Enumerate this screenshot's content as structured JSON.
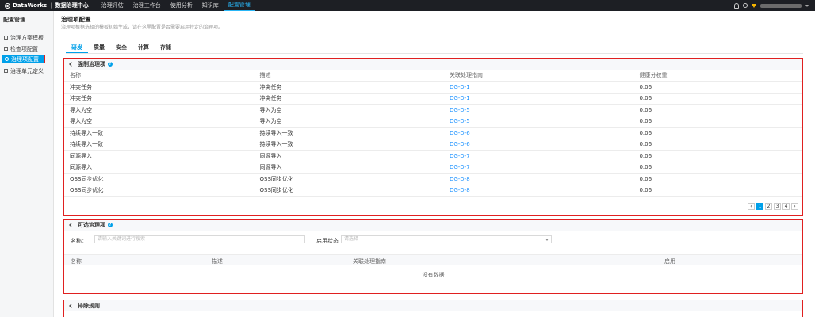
{
  "topbar": {
    "brand": "DataWorks",
    "product": "数据治理中心",
    "nav": [
      "治理评估",
      "治理工作台",
      "使用分析",
      "知识库",
      "配置管理"
    ],
    "active_nav": 4
  },
  "sidebar": {
    "title": "配置管理",
    "items": [
      {
        "label": "治理方案模板"
      },
      {
        "label": "检查项配置"
      },
      {
        "label": "治理项配置"
      },
      {
        "label": "治理单元定义"
      }
    ],
    "active": 2
  },
  "page": {
    "title": "治理项配置",
    "desc": "治理项根据选择的模板初始生成，请在这里配置是否需要启用特定的治理项。"
  },
  "tabs": [
    "研发",
    "质量",
    "安全",
    "计算",
    "存储"
  ],
  "forced": {
    "title": "强制治理项",
    "help": "?",
    "columns": [
      "名称",
      "描述",
      "关联处理指南",
      "健康分权重"
    ],
    "rows": [
      [
        "冲突任务",
        "冲突任务",
        "DG-D-1",
        "0.06"
      ],
      [
        "冲突任务",
        "冲突任务",
        "DG-D-1",
        "0.06"
      ],
      [
        "导入为空",
        "导入为空",
        "DG-D-5",
        "0.06"
      ],
      [
        "导入为空",
        "导入为空",
        "DG-D-5",
        "0.06"
      ],
      [
        "持续导入一致",
        "持续导入一致",
        "DG-D-6",
        "0.06"
      ],
      [
        "持续导入一致",
        "持续导入一致",
        "DG-D-6",
        "0.06"
      ],
      [
        "同源导入",
        "同源导入",
        "DG-D-7",
        "0.06"
      ],
      [
        "同源导入",
        "同源导入",
        "DG-D-7",
        "0.06"
      ],
      [
        "OSS同步优化",
        "OSS同步优化",
        "DG-D-8",
        "0.06"
      ],
      [
        "OSS同步优化",
        "OSS同步优化",
        "DG-D-8",
        "0.06"
      ]
    ],
    "pager": {
      "prev": "‹",
      "pages": [
        "1",
        "2",
        "3",
        "4"
      ],
      "next": "›",
      "current": 0
    }
  },
  "optional": {
    "title": "可选治理项",
    "help": "?",
    "name_label": "名称：",
    "name_placeholder": "请输入关键词进行搜索",
    "status_label": "启用状态",
    "status_placeholder": "请选择",
    "columns": [
      "名称",
      "描述",
      "关联处理指南",
      "启用"
    ],
    "empty": "没有数据"
  },
  "exclude": {
    "title": "排除规则"
  }
}
